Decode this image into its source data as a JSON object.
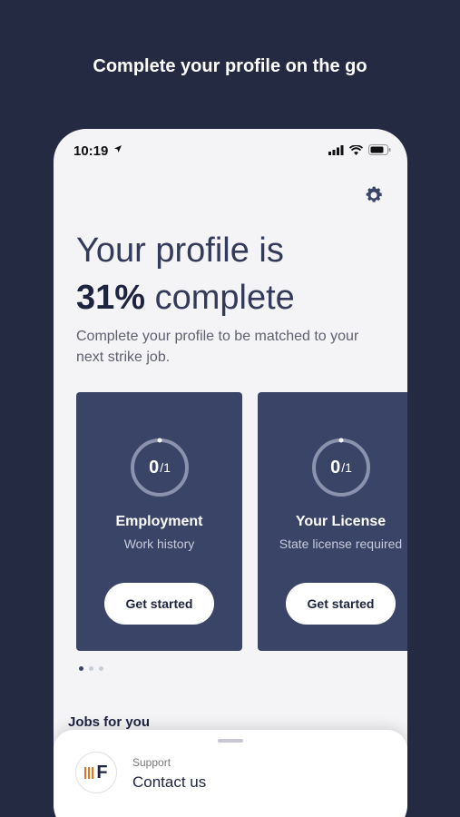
{
  "promo": {
    "title": "Complete your profile on the go"
  },
  "status_bar": {
    "time": "10:19"
  },
  "headline": {
    "line1": "Your profile is",
    "percent": "31%",
    "line2_rest": " complete"
  },
  "subtext": "Complete your profile to be matched to your next strike job.",
  "cards": [
    {
      "progress": "0",
      "total": "/1",
      "title": "Employment",
      "subtitle": "Work history",
      "button": "Get started"
    },
    {
      "progress": "0",
      "total": "/1",
      "title": "Your License",
      "subtitle": "State license required",
      "button": "Get started"
    }
  ],
  "pagination": {
    "pages": 3,
    "active": 1
  },
  "jobs": {
    "title": "Jobs for you"
  },
  "support_sheet": {
    "label": "Support",
    "title": "Contact us",
    "logo_letter": "F"
  },
  "colors": {
    "background": "#232a42",
    "card": "#3a4467",
    "accent_logo": "#e8731b"
  }
}
